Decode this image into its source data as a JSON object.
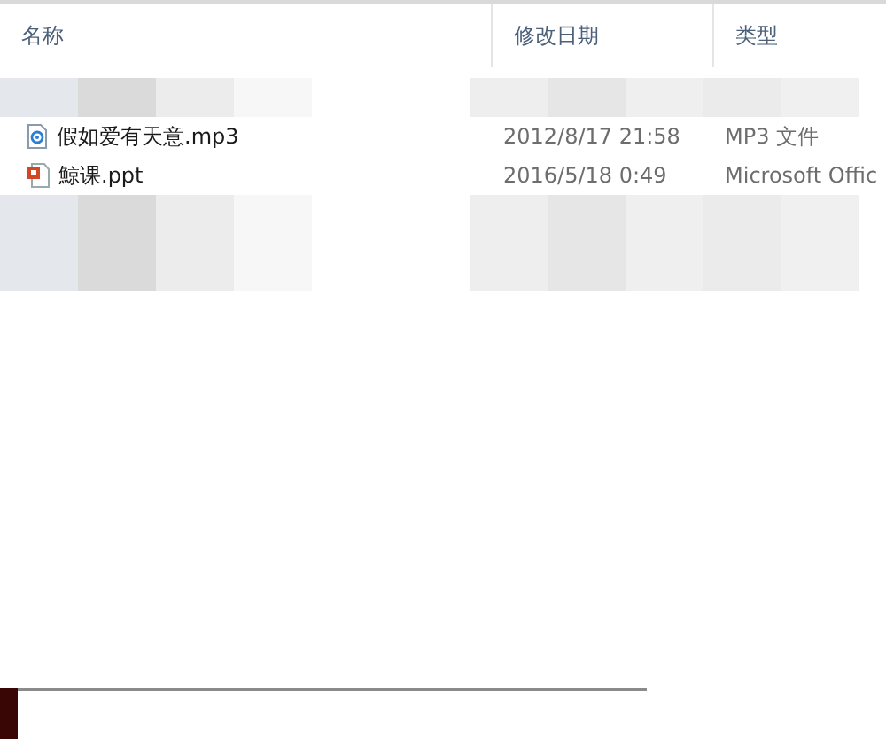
{
  "columns": [
    {
      "label": "名称"
    },
    {
      "label": "修改日期"
    },
    {
      "label": "类型"
    }
  ],
  "rows": [
    {
      "kind": "redacted"
    },
    {
      "kind": "audio",
      "name": "假如爱有天意.mp3",
      "date": "2012/8/17 21:58",
      "type": "MP3 文件"
    },
    {
      "kind": "slides",
      "name": "鯨课.ppt",
      "date": "2016/5/18 0:49",
      "type": "Microsoft Offic"
    },
    {
      "kind": "redacted"
    },
    {
      "kind": "redacted"
    }
  ]
}
